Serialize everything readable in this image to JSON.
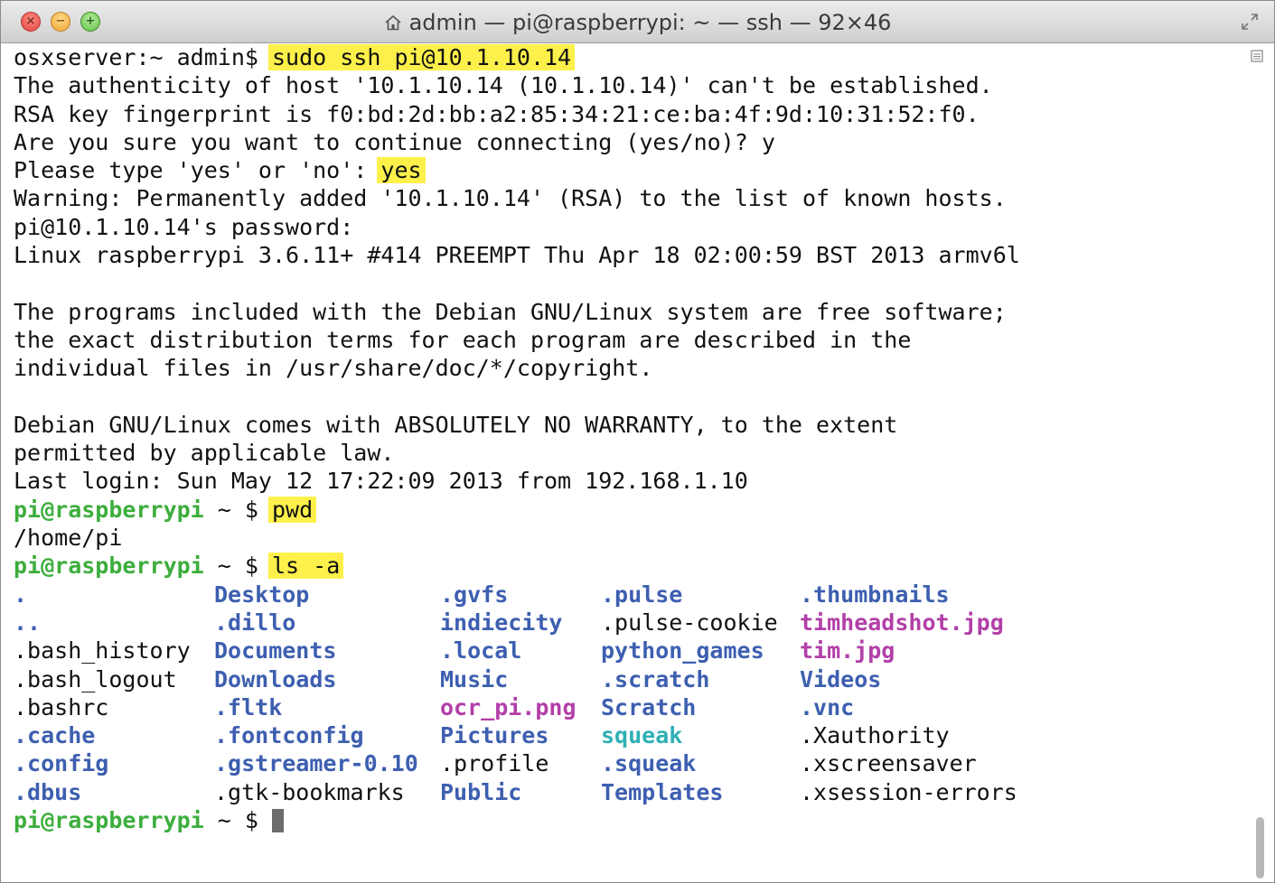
{
  "window": {
    "title": "admin — pi@raspberrypi: ~ — ssh — 92×46",
    "controls": {
      "close": "×",
      "minimize": "−",
      "zoom": "+"
    }
  },
  "colors": {
    "highlight": "#fdf04a",
    "prompt_green": "#3cae3c",
    "dir_blue": "#3d5fb0",
    "image_magenta": "#b23fa8",
    "cyan": "#2eb0b4"
  },
  "terminal": {
    "lines": [
      "osxserver:~ admin$ ",
      "The authenticity of host '10.1.10.14 (10.1.10.14)' can't be established.",
      "RSA key fingerprint is f0:bd:2d:bb:a2:85:34:21:ce:ba:4f:9d:10:31:52:f0.",
      "Are you sure you want to continue connecting (yes/no)? y",
      "Please type 'yes' or 'no': ",
      "Warning: Permanently added '10.1.10.14' (RSA) to the list of known hosts.",
      "pi@10.1.10.14's password:",
      "Linux raspberrypi 3.6.11+ #414 PREEMPT Thu Apr 18 02:00:59 BST 2013 armv6l",
      "",
      "The programs included with the Debian GNU/Linux system are free software;",
      "the exact distribution terms for each program are described in the",
      "individual files in /usr/share/doc/*/copyright.",
      "",
      "Debian GNU/Linux comes with ABSOLUTELY NO WARRANTY, to the extent",
      "permitted by applicable law.",
      "Last login: Sun May 12 17:22:09 2013 from 192.168.1.10"
    ],
    "cmd_ssh": "sudo ssh pi@10.1.10.14",
    "answer_yes": "yes",
    "prompt_user": "pi@raspberrypi",
    "prompt_rest": " ~ $ ",
    "cmd_pwd": "pwd",
    "pwd_output": "/home/pi",
    "cmd_ls": "ls -a",
    "ls_rows": [
      [
        ".",
        "Desktop",
        ".gvfs",
        ".pulse",
        ".thumbnails"
      ],
      [
        "..",
        ".dillo",
        "indiecity",
        ".pulse-cookie",
        "timheadshot.jpg"
      ],
      [
        ".bash_history",
        "Documents",
        ".local",
        "python_games",
        "tim.jpg"
      ],
      [
        ".bash_logout",
        "Downloads",
        "Music",
        ".scratch",
        "Videos"
      ],
      [
        ".bashrc",
        ".fltk",
        "ocr_pi.png",
        "Scratch",
        ".vnc"
      ],
      [
        ".cache",
        ".fontconfig",
        "Pictures",
        "squeak",
        ".Xauthority"
      ],
      [
        ".config",
        ".gstreamer-0.10",
        ".profile",
        ".squeak",
        ".xscreensaver"
      ],
      [
        ".dbus",
        ".gtk-bookmarks",
        "Public",
        "Templates",
        ".xsession-errors"
      ]
    ],
    "ls_classes": [
      [
        "b",
        "b",
        "b",
        "b",
        "b"
      ],
      [
        "b",
        "b",
        "b",
        "",
        "m"
      ],
      [
        "",
        "b",
        "b",
        "b",
        "m"
      ],
      [
        "",
        "b",
        "b",
        "b",
        "b"
      ],
      [
        "",
        "b",
        "m",
        "b",
        "b"
      ],
      [
        "b",
        "b",
        "b",
        "c",
        ""
      ],
      [
        "b",
        "b",
        "",
        "b",
        ""
      ],
      [
        "b",
        "",
        "b",
        "b",
        ""
      ]
    ]
  }
}
